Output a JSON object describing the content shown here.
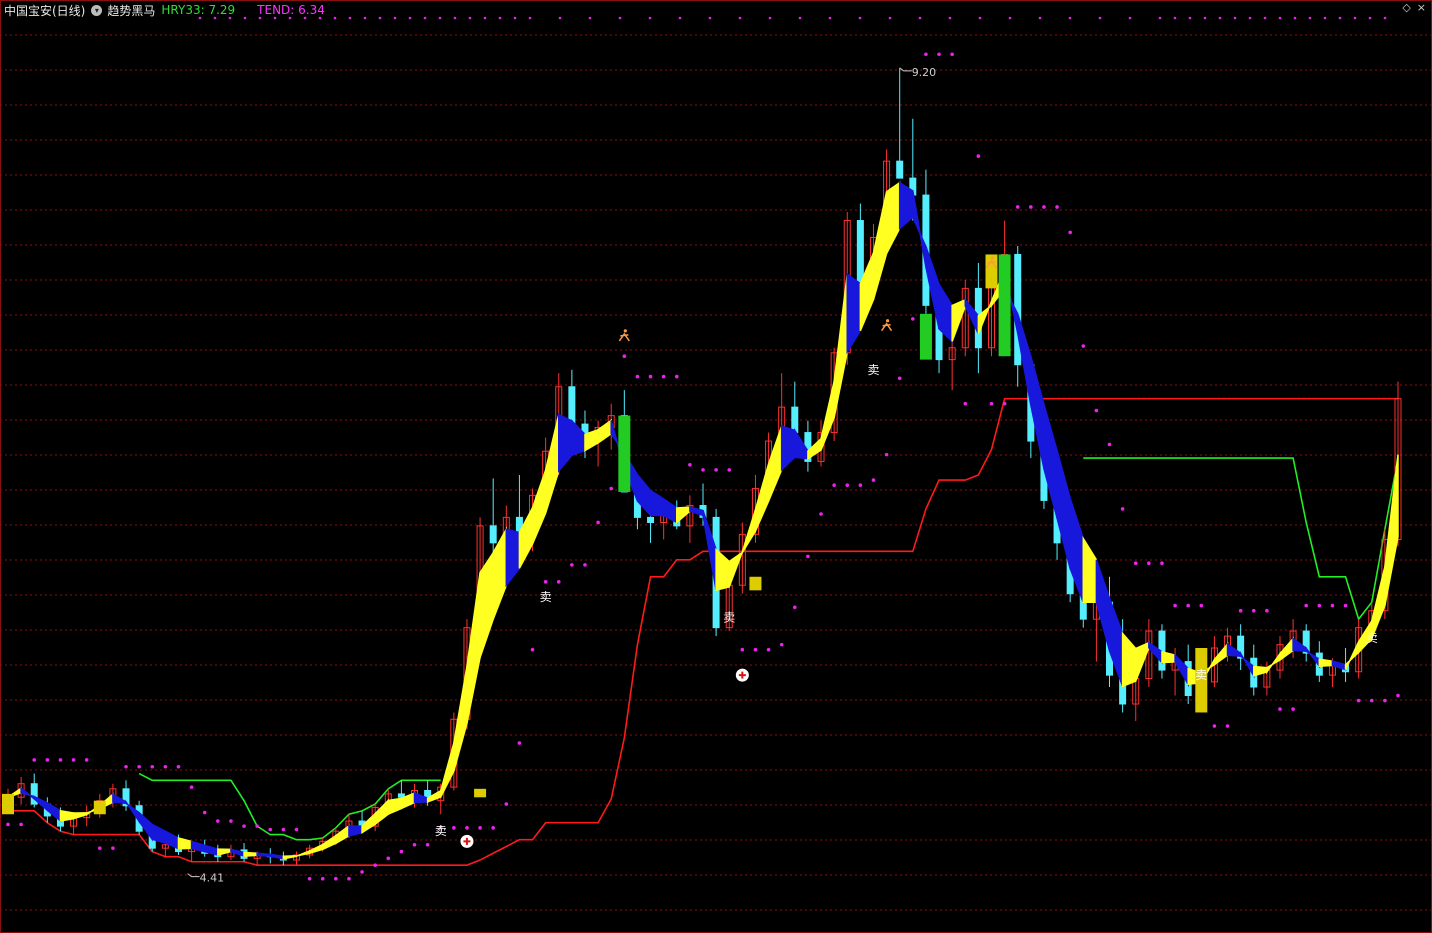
{
  "header": {
    "stock_title": "中国宝安(日线)",
    "indicator_name": "趋势黑马",
    "hry_label": "HRY33: 7.29",
    "tend_label": "TEND: 6.34"
  },
  "corner_icons": [
    "diamond-icon",
    "close-icon"
  ],
  "colors": {
    "background": "#000000",
    "grid": "#8a1010",
    "up_candle": "#ff3030",
    "down_candle": "#55eeff",
    "trend_up": "#ffff22",
    "trend_down": "#1818dd",
    "support": "#ff1a1a",
    "resistance": "#22ee22",
    "dots": "#ee22ee",
    "signal_green": "#22cc22",
    "signal_gold": "#ddcc00"
  },
  "chart_data": {
    "type": "candlestick",
    "title": "中国宝安(日线)",
    "ylim": [
      4.1,
      9.6
    ],
    "extremes": {
      "high_label": "9.20",
      "low_label": "4.41"
    },
    "candles": [
      [
        4.86,
        4.95,
        4.82,
        4.9
      ],
      [
        4.9,
        5.02,
        4.86,
        4.98
      ],
      [
        4.98,
        5.04,
        4.84,
        4.86
      ],
      [
        4.86,
        4.9,
        4.75,
        4.79
      ],
      [
        4.79,
        4.84,
        4.7,
        4.73
      ],
      [
        4.73,
        4.8,
        4.68,
        4.78
      ],
      [
        4.78,
        4.85,
        4.73,
        4.81
      ],
      [
        4.81,
        4.92,
        4.78,
        4.88
      ],
      [
        4.88,
        4.98,
        4.84,
        4.95
      ],
      [
        4.95,
        5.0,
        4.82,
        4.85
      ],
      [
        4.85,
        4.88,
        4.68,
        4.7
      ],
      [
        4.7,
        4.73,
        4.58,
        4.6
      ],
      [
        4.6,
        4.66,
        4.55,
        4.62
      ],
      [
        4.62,
        4.68,
        4.56,
        4.58
      ],
      [
        4.58,
        4.63,
        4.52,
        4.6
      ],
      [
        4.6,
        4.65,
        4.55,
        4.57
      ],
      [
        4.57,
        4.62,
        4.52,
        4.55
      ],
      [
        4.55,
        4.62,
        4.53,
        4.59
      ],
      [
        4.59,
        4.63,
        4.52,
        4.54
      ],
      [
        4.54,
        4.58,
        4.5,
        4.56
      ],
      [
        4.56,
        4.6,
        4.51,
        4.55
      ],
      [
        4.55,
        4.58,
        4.5,
        4.53
      ],
      [
        4.53,
        4.58,
        4.5,
        4.56
      ],
      [
        4.56,
        4.62,
        4.54,
        4.6
      ],
      [
        4.6,
        4.66,
        4.58,
        4.64
      ],
      [
        4.64,
        4.72,
        4.62,
        4.7
      ],
      [
        4.7,
        4.8,
        4.66,
        4.76
      ],
      [
        4.76,
        4.82,
        4.7,
        4.73
      ],
      [
        4.73,
        4.86,
        4.7,
        4.84
      ],
      [
        4.84,
        4.95,
        4.8,
        4.92
      ],
      [
        4.92,
        5.0,
        4.86,
        4.9
      ],
      [
        4.9,
        4.98,
        4.84,
        4.94
      ],
      [
        4.94,
        5.0,
        4.85,
        4.88
      ],
      [
        4.88,
        4.98,
        4.8,
        4.96
      ],
      [
        4.96,
        5.4,
        4.94,
        5.36
      ],
      [
        5.36,
        5.95,
        5.3,
        5.9
      ],
      [
        5.9,
        6.55,
        5.85,
        6.5
      ],
      [
        6.5,
        6.78,
        6.3,
        6.4
      ],
      [
        6.4,
        6.62,
        6.25,
        6.55
      ],
      [
        6.55,
        6.8,
        6.4,
        6.45
      ],
      [
        6.45,
        6.72,
        6.35,
        6.68
      ],
      [
        6.68,
        7.02,
        6.6,
        6.94
      ],
      [
        6.94,
        7.4,
        6.8,
        7.32
      ],
      [
        7.32,
        7.42,
        7.0,
        7.1
      ],
      [
        7.1,
        7.18,
        6.9,
        7.0
      ],
      [
        7.0,
        7.12,
        6.85,
        7.08
      ],
      [
        7.08,
        7.22,
        6.95,
        7.15
      ],
      [
        7.15,
        7.3,
        6.88,
        6.7
      ],
      [
        6.7,
        6.78,
        6.48,
        6.55
      ],
      [
        6.55,
        6.62,
        6.4,
        6.52
      ],
      [
        6.52,
        6.6,
        6.42,
        6.56
      ],
      [
        6.56,
        6.65,
        6.48,
        6.5
      ],
      [
        6.5,
        6.68,
        6.4,
        6.62
      ],
      [
        6.62,
        6.75,
        6.5,
        6.55
      ],
      [
        6.55,
        6.6,
        5.85,
        5.9
      ],
      [
        5.9,
        6.2,
        5.88,
        6.15
      ],
      [
        6.15,
        6.52,
        6.1,
        6.45
      ],
      [
        6.45,
        6.8,
        6.4,
        6.72
      ],
      [
        6.72,
        7.05,
        6.65,
        7.0
      ],
      [
        7.0,
        7.4,
        6.92,
        7.2
      ],
      [
        7.2,
        7.35,
        6.95,
        7.05
      ],
      [
        7.05,
        7.12,
        6.82,
        6.88
      ],
      [
        6.88,
        7.12,
        6.85,
        7.05
      ],
      [
        7.05,
        7.55,
        7.0,
        7.52
      ],
      [
        7.52,
        8.35,
        7.45,
        8.3
      ],
      [
        8.3,
        8.4,
        7.8,
        7.9
      ],
      [
        7.9,
        8.28,
        7.85,
        8.2
      ],
      [
        8.2,
        8.72,
        8.15,
        8.65
      ],
      [
        8.65,
        9.2,
        8.6,
        8.55
      ],
      [
        8.55,
        8.9,
        8.3,
        8.45
      ],
      [
        8.45,
        8.6,
        7.75,
        7.8
      ],
      [
        7.8,
        7.92,
        7.4,
        7.48
      ],
      [
        7.48,
        7.6,
        7.3,
        7.55
      ],
      [
        7.55,
        7.95,
        7.5,
        7.9
      ],
      [
        7.9,
        8.05,
        7.4,
        7.55
      ],
      [
        7.55,
        7.98,
        7.5,
        7.92
      ],
      [
        7.92,
        8.3,
        7.88,
        8.1
      ],
      [
        8.1,
        8.15,
        7.32,
        7.45
      ],
      [
        7.45,
        7.48,
        6.9,
        7.0
      ],
      [
        7.0,
        7.1,
        6.6,
        6.65
      ],
      [
        6.65,
        6.9,
        6.3,
        6.4
      ],
      [
        6.4,
        6.52,
        6.05,
        6.1
      ],
      [
        6.1,
        6.2,
        5.9,
        5.95
      ],
      [
        5.95,
        6.18,
        5.7,
        6.05
      ],
      [
        6.05,
        6.2,
        5.55,
        5.62
      ],
      [
        5.62,
        5.95,
        5.4,
        5.45
      ],
      [
        5.45,
        5.7,
        5.35,
        5.6
      ],
      [
        5.6,
        5.95,
        5.55,
        5.88
      ],
      [
        5.88,
        5.92,
        5.6,
        5.65
      ],
      [
        5.65,
        5.78,
        5.5,
        5.7
      ],
      [
        5.7,
        5.8,
        5.45,
        5.5
      ],
      [
        5.5,
        5.62,
        5.4,
        5.58
      ],
      [
        5.58,
        5.85,
        5.55,
        5.78
      ],
      [
        5.78,
        5.9,
        5.7,
        5.85
      ],
      [
        5.85,
        5.92,
        5.65,
        5.72
      ],
      [
        5.72,
        5.8,
        5.5,
        5.55
      ],
      [
        5.55,
        5.7,
        5.5,
        5.65
      ],
      [
        5.65,
        5.85,
        5.6,
        5.8
      ],
      [
        5.8,
        5.95,
        5.72,
        5.88
      ],
      [
        5.88,
        5.92,
        5.7,
        5.75
      ],
      [
        5.75,
        5.82,
        5.58,
        5.62
      ],
      [
        5.62,
        5.72,
        5.55,
        5.68
      ],
      [
        5.68,
        5.78,
        5.58,
        5.64
      ],
      [
        5.64,
        5.95,
        5.6,
        5.9
      ],
      [
        5.9,
        6.05,
        5.82,
        6.0
      ],
      [
        6.0,
        6.48,
        5.95,
        6.42
      ],
      [
        6.42,
        7.35,
        6.38,
        7.25
      ]
    ],
    "annotations": [
      {
        "text": "9.20",
        "kind": "high"
      },
      {
        "text": "4.41",
        "kind": "low"
      },
      {
        "text": "卖",
        "kind": "sell"
      },
      {
        "text": "卖",
        "kind": "sell"
      },
      {
        "text": "卖",
        "kind": "sell"
      },
      {
        "text": "卖",
        "kind": "sell"
      },
      {
        "text": "卖",
        "kind": "sell"
      },
      {
        "text": "卖",
        "kind": "sell"
      }
    ]
  }
}
